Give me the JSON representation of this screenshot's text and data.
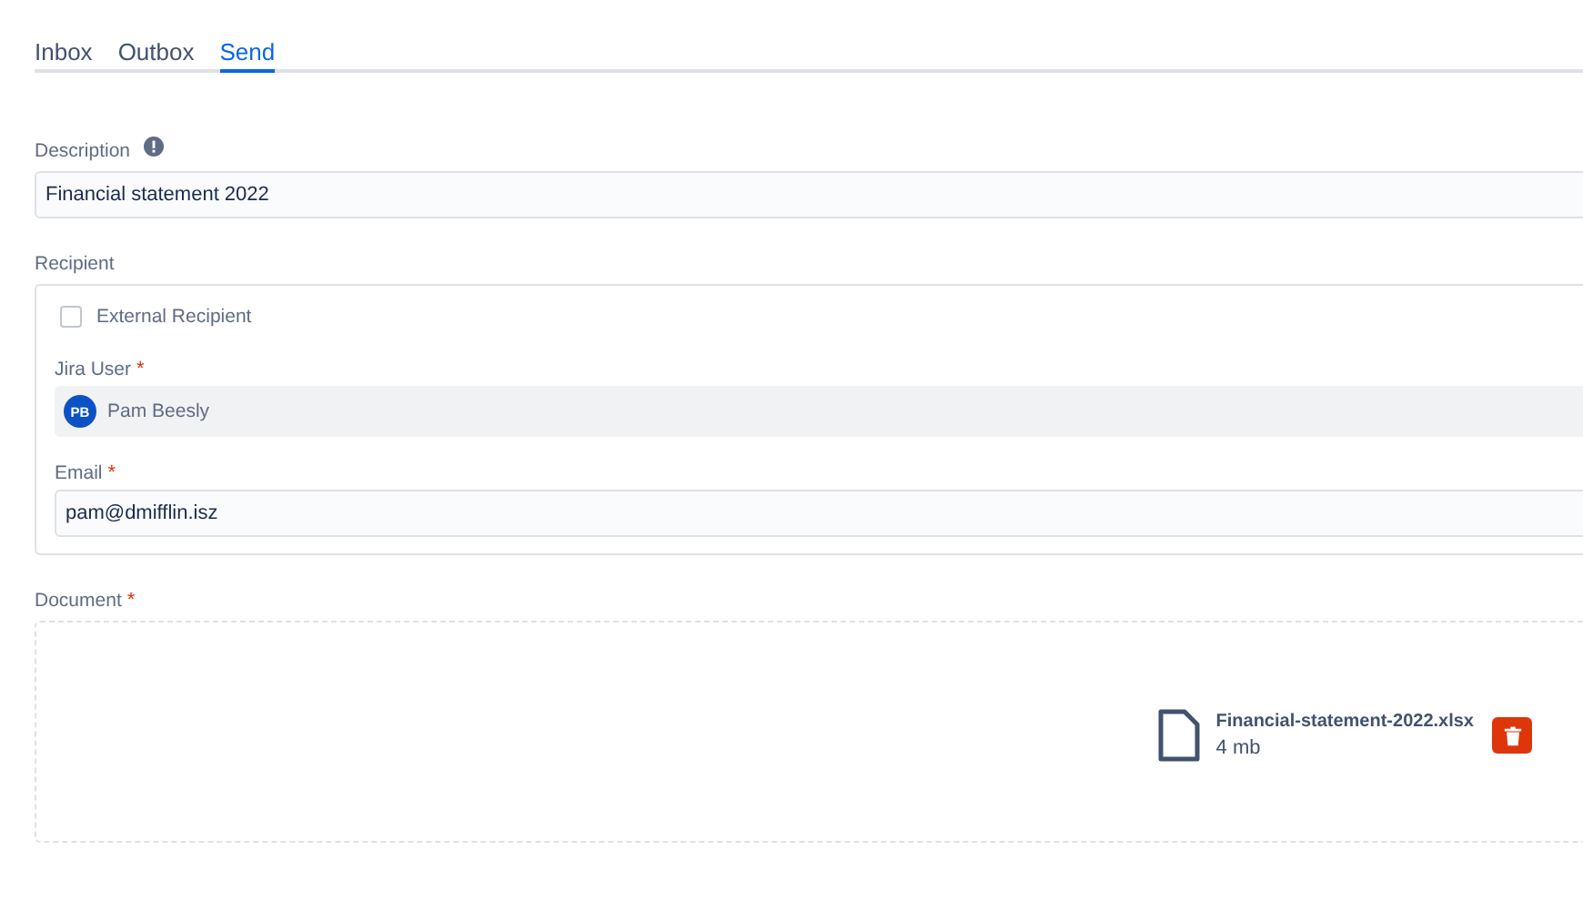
{
  "tabs": [
    {
      "label": "Inbox",
      "selected": false
    },
    {
      "label": "Outbox",
      "selected": false
    },
    {
      "label": "Send",
      "selected": true
    }
  ],
  "description": {
    "label": "Description",
    "value": "Financial statement 2022"
  },
  "recipient": {
    "label": "Recipient",
    "external": {
      "label": "External Recipient",
      "checked": false
    },
    "jira_user": {
      "label": "Jira User",
      "required_mark": "*",
      "initials": "PB",
      "name": "Pam Beesly"
    },
    "email": {
      "label": "Email",
      "required_mark": "*",
      "value": "pam@dmifflin.isz"
    }
  },
  "document": {
    "label": "Document",
    "required_mark": "*",
    "file": {
      "name": "Financial-statement-2022.xlsx",
      "size": "4 mb"
    }
  }
}
